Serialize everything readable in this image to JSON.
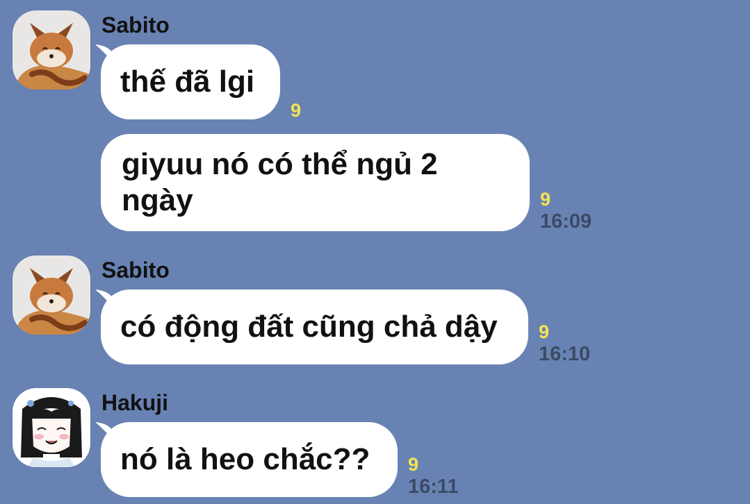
{
  "colors": {
    "background": "#6883b3",
    "bubble": "#ffffff",
    "read_receipt": "#f5e44f",
    "timestamp": "#3b4a64"
  },
  "messages": [
    {
      "sender": "Sabito",
      "avatar_icon": "fox-avatar-icon",
      "text": "thế đã lgi",
      "read": "9"
    },
    {
      "text": "giyuu nó có thể ngủ 2 ngày",
      "read": "9",
      "time": "16:09"
    },
    {
      "sender": "Sabito",
      "avatar_icon": "fox-avatar-icon",
      "text": "có động đất cũng chả dậy",
      "read": "9",
      "time": "16:10"
    },
    {
      "sender": "Hakuji",
      "avatar_icon": "anime-girl-avatar-icon",
      "text": "nó là heo chắc??",
      "read": "9",
      "time": "16:11"
    }
  ]
}
